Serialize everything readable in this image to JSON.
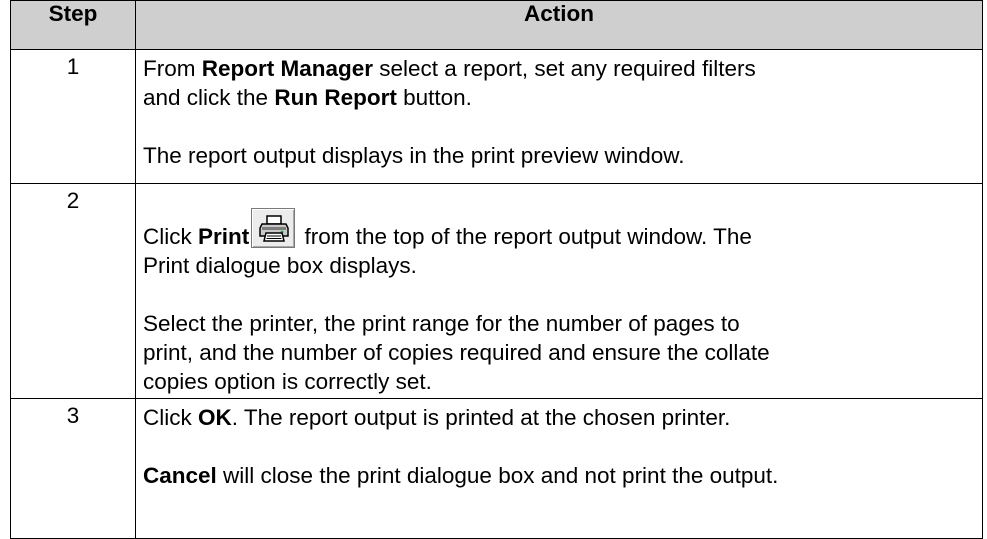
{
  "table": {
    "headers": {
      "step": "Step",
      "action": "Action"
    },
    "rows": [
      {
        "step": "1",
        "lines": [
          {
            "pre": "From ",
            "b1": "Report Manager",
            "mid": " select a report, set any required filters"
          },
          {
            "pre": "and click the ",
            "b1": "Run Report",
            "mid": " button."
          },
          {
            "plain": "The report output displays in the print preview window."
          }
        ]
      },
      {
        "step": "2",
        "click_pre": "Click ",
        "click_bold": "Print",
        "click_post": " from the top of the report output window. The",
        "click_line2": "Print dialogue box displays.",
        "select_lines": [
          "Select the printer, the print range for the number of pages to",
          "print, and the number of copies required and ensure the collate",
          "copies option is correctly set."
        ],
        "print_button_icon": "printer-icon"
      },
      {
        "step": "3",
        "ok_pre": "Click ",
        "ok_bold": "OK",
        "ok_post": ". The report output is printed at the chosen printer.",
        "cancel_bold": "Cancel",
        "cancel_post": " will close the print dialogue box and not print the output."
      }
    ]
  }
}
